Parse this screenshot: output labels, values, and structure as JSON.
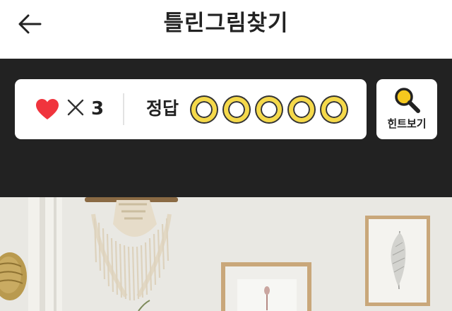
{
  "header": {
    "title": "틀린그림찾기"
  },
  "status": {
    "lives": "3",
    "answer_label": "정답",
    "answer_slots": 5
  },
  "hint": {
    "label": "힌트보기"
  },
  "colors": {
    "dark_bar": "#222222",
    "heart": "#f0343d",
    "slot_fill": "#f5d94a",
    "hint_icon": "#f5c81e"
  },
  "icons": {
    "back": "arrow-left-icon",
    "heart": "heart-icon",
    "times": "times-icon",
    "hint": "magnifier-icon"
  }
}
